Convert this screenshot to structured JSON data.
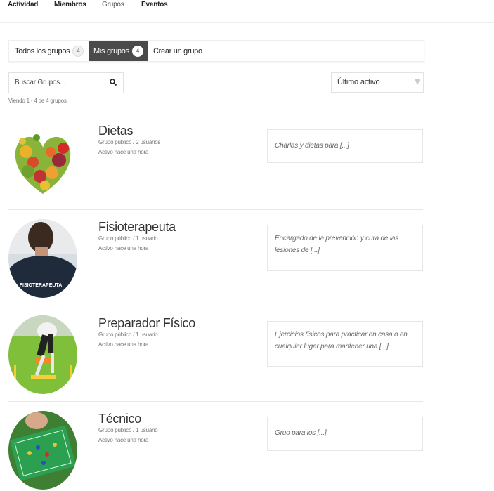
{
  "nav": {
    "activity": "Actividad",
    "members": "Miembros",
    "groups": "Grupos",
    "events": "Eventos"
  },
  "tabs": {
    "all_label": "Todos los grupos",
    "all_count": "4",
    "mine_label": "Mis grupos",
    "mine_count": "4",
    "create_label": "Crear un grupo"
  },
  "search": {
    "placeholder": "Buscar Grupos..."
  },
  "sort": {
    "selected": "Último activo"
  },
  "viewing_text": "Viendo 1 - 4 de 4 grupos",
  "groups": [
    {
      "name": "Dietas",
      "meta": "Grupo público / 2 usuarios",
      "activity": "Activo hace una hora",
      "description": "Charlas y dietas para [...]"
    },
    {
      "name": "Fisioterapeuta",
      "meta": "Grupo público / 1 usuario",
      "activity": "Activo hace una hora",
      "description": "Encargado de la prevención y cura de las lesiones de [...]",
      "avatar_text": "FISIOTERAPEUTA"
    },
    {
      "name": "Preparador Físico",
      "meta": "Grupo público / 1 usuario",
      "activity": "Activo hace una hora",
      "description": "Ejercicios físicos para practicar en casa o en cualquier lugar para mantener una [...]"
    },
    {
      "name": "Técnico",
      "meta": "Grupo público / 1 usuario",
      "activity": "Activo hace una hora",
      "description": "Gruo para los [...]"
    }
  ],
  "colors": {
    "active_tab": "#4a4a4a",
    "border": "#e6e6e6"
  }
}
